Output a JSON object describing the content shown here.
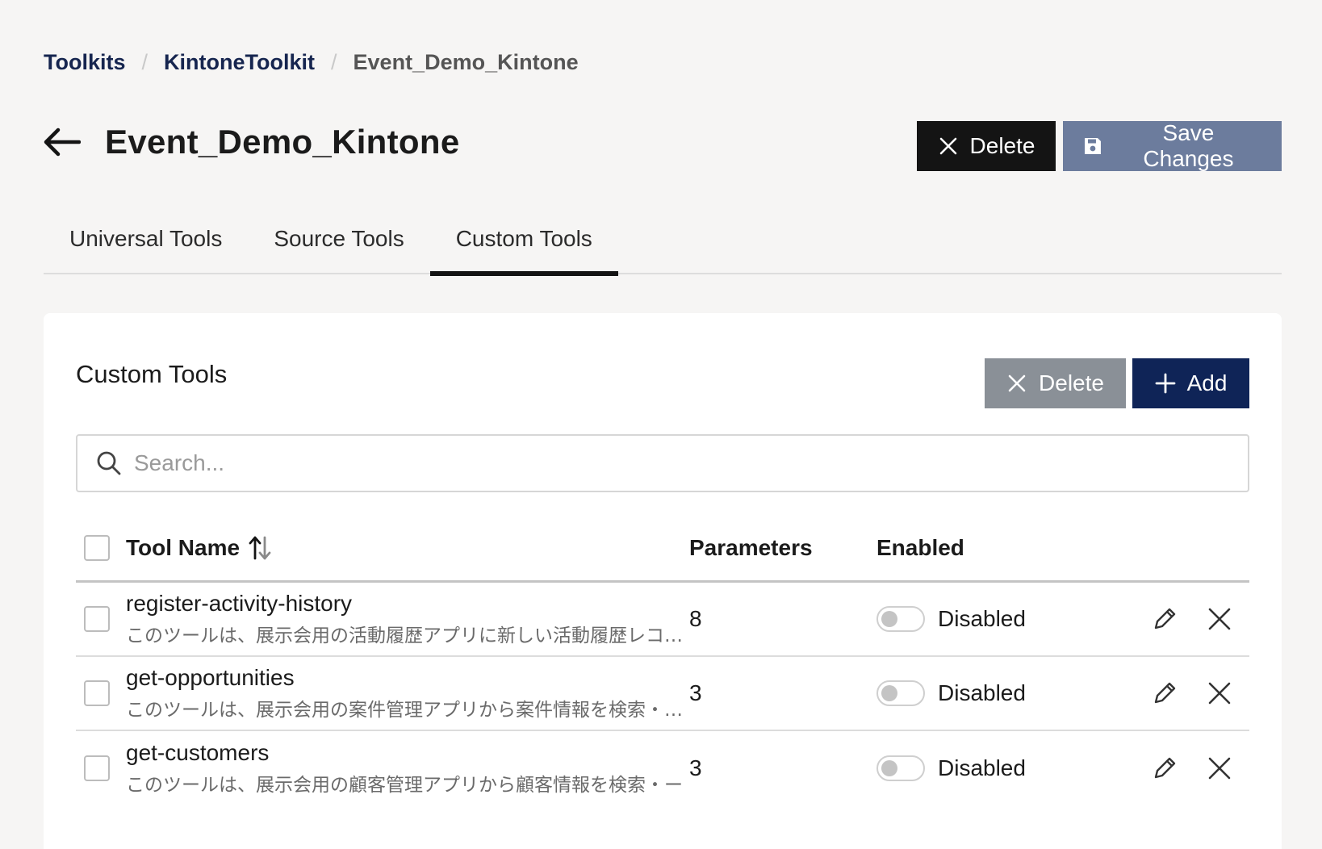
{
  "breadcrumb": {
    "items": [
      "Toolkits",
      "KintoneToolkit"
    ],
    "current": "Event_Demo_Kintone",
    "separator": "/"
  },
  "header": {
    "title": "Event_Demo_Kintone",
    "delete_label": "Delete",
    "save_label": "Save Changes"
  },
  "tabs": [
    {
      "label": "Universal Tools",
      "active": false
    },
    {
      "label": "Source Tools",
      "active": false
    },
    {
      "label": "Custom Tools",
      "active": true
    }
  ],
  "panel": {
    "title": "Custom Tools",
    "delete_label": "Delete",
    "add_label": "Add",
    "search_placeholder": "Search..."
  },
  "table": {
    "headers": {
      "name": "Tool Name",
      "params": "Parameters",
      "enabled": "Enabled"
    },
    "rows": [
      {
        "name": "register-activity-history",
        "desc": "このツールは、展示会用の活動履歴アプリに新しい活動履歴レコ…",
        "params": "8",
        "status": "Disabled"
      },
      {
        "name": "get-opportunities",
        "desc": "このツールは、展示会用の案件管理アプリから案件情報を検索・…",
        "params": "3",
        "status": "Disabled"
      },
      {
        "name": "get-customers",
        "desc": "このツールは、展示会用の顧客管理アプリから顧客情報を検索・ー",
        "params": "3",
        "status": "Disabled"
      }
    ]
  },
  "colors": {
    "background": "#f6f5f4",
    "navy": "#0f2457",
    "slate": "#6c7c9d",
    "dark": "#141414",
    "gray_button": "#8a9097"
  },
  "icons": [
    "arrow-left-icon",
    "close-icon",
    "save-icon",
    "plus-icon",
    "search-icon",
    "sort-icon",
    "pencil-icon"
  ]
}
